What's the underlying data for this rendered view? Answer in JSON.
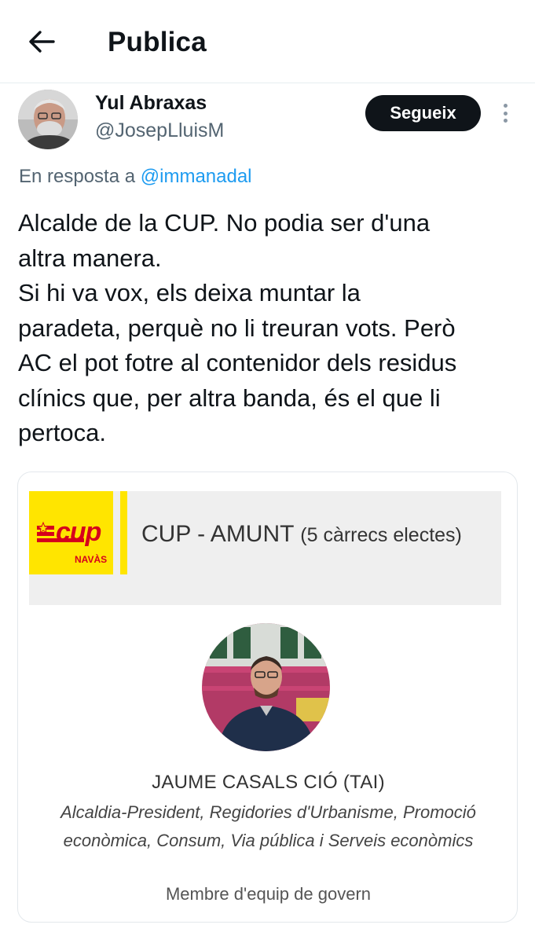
{
  "header": {
    "title": "Publica",
    "back_icon": "arrow-left-icon"
  },
  "post": {
    "author_name": "Yul Abraxas",
    "author_handle": "@JosepLluisM",
    "follow_label": "Segueix",
    "more_icon": "more-vertical-icon",
    "reply_prefix": "En resposta a",
    "reply_mention": "@immanadal",
    "text_lines": [
      "Alcalde de la CUP. No podia ser d'una",
      "altra manera.",
      "Si hi va vox, els deixa muntar la",
      "paradeta, perquè no li treuran vots. Però",
      "AC el pot fotre al contenidor dels residus",
      "clínics que, per altra banda, és el que li",
      "pertoca."
    ]
  },
  "card": {
    "logo_text": "cup",
    "logo_sub": "NAVÀS",
    "title_main": "CUP - AMUNT",
    "title_sub": "(5 càrrecs electes)",
    "person_name": "JAUME CASALS CIÓ (TAI)",
    "person_roles": "Alcaldia-President, Regidories d'Urbanisme, Promoció econòmica, Consum, Via pública i Serveis econòmics",
    "person_team": "Membre d'equip de govern"
  },
  "colors": {
    "text": "#0f1419",
    "muted": "#536471",
    "link": "#1d9bf0",
    "cup_yellow": "#ffe500",
    "cup_red": "#d6001c"
  }
}
